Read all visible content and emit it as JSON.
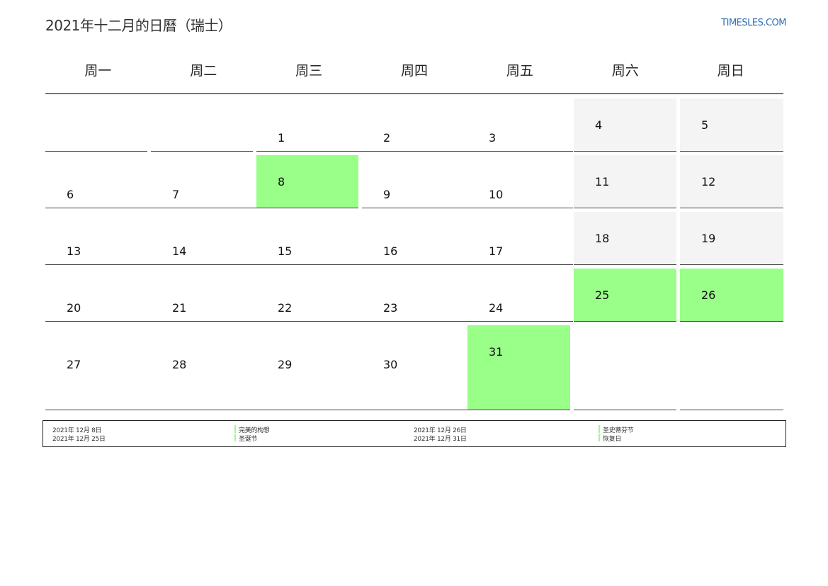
{
  "header": {
    "title": "2021年十二月的日曆（瑞士）",
    "site": "TIMESLES.COM"
  },
  "weekdays": [
    "周一",
    "周二",
    "周三",
    "周四",
    "周五",
    "周六",
    "周日"
  ],
  "calendar": {
    "weeks": [
      [
        {
          "day": "",
          "type": "blank"
        },
        {
          "day": "",
          "type": "blank"
        },
        {
          "day": "1",
          "type": "weekday"
        },
        {
          "day": "2",
          "type": "weekday"
        },
        {
          "day": "3",
          "type": "weekday"
        },
        {
          "day": "4",
          "type": "weekend"
        },
        {
          "day": "5",
          "type": "weekend"
        }
      ],
      [
        {
          "day": "6",
          "type": "weekday"
        },
        {
          "day": "7",
          "type": "weekday"
        },
        {
          "day": "8",
          "type": "holiday"
        },
        {
          "day": "9",
          "type": "weekday"
        },
        {
          "day": "10",
          "type": "weekday"
        },
        {
          "day": "11",
          "type": "weekend"
        },
        {
          "day": "12",
          "type": "weekend"
        }
      ],
      [
        {
          "day": "13",
          "type": "weekday"
        },
        {
          "day": "14",
          "type": "weekday"
        },
        {
          "day": "15",
          "type": "weekday"
        },
        {
          "day": "16",
          "type": "weekday"
        },
        {
          "day": "17",
          "type": "weekday"
        },
        {
          "day": "18",
          "type": "weekend"
        },
        {
          "day": "19",
          "type": "weekend"
        }
      ],
      [
        {
          "day": "20",
          "type": "weekday"
        },
        {
          "day": "21",
          "type": "weekday"
        },
        {
          "day": "22",
          "type": "weekday"
        },
        {
          "day": "23",
          "type": "weekday"
        },
        {
          "day": "24",
          "type": "weekday"
        },
        {
          "day": "25",
          "type": "holiday"
        },
        {
          "day": "26",
          "type": "holiday"
        }
      ],
      [
        {
          "day": "27",
          "type": "weekday"
        },
        {
          "day": "28",
          "type": "weekday"
        },
        {
          "day": "29",
          "type": "weekday"
        },
        {
          "day": "30",
          "type": "weekday"
        },
        {
          "day": "31",
          "type": "holiday"
        },
        {
          "day": "",
          "type": "blank"
        },
        {
          "day": "",
          "type": "blank"
        }
      ]
    ]
  },
  "legend": {
    "items": [
      {
        "date": "2021年 12月 8日",
        "name": "完美的构想"
      },
      {
        "date": "2021年 12月 25日",
        "name": "圣诞节"
      },
      {
        "date": "2021年 12月 26日",
        "name": "圣史蒂芬节"
      },
      {
        "date": "2021年 12月 31日",
        "name": "恢复日"
      }
    ]
  },
  "colors": {
    "holiday": "#99ff88",
    "weekend": "#f4f4f4",
    "header_rule": "#5d7b9c",
    "site_link": "#2f6eb5"
  }
}
